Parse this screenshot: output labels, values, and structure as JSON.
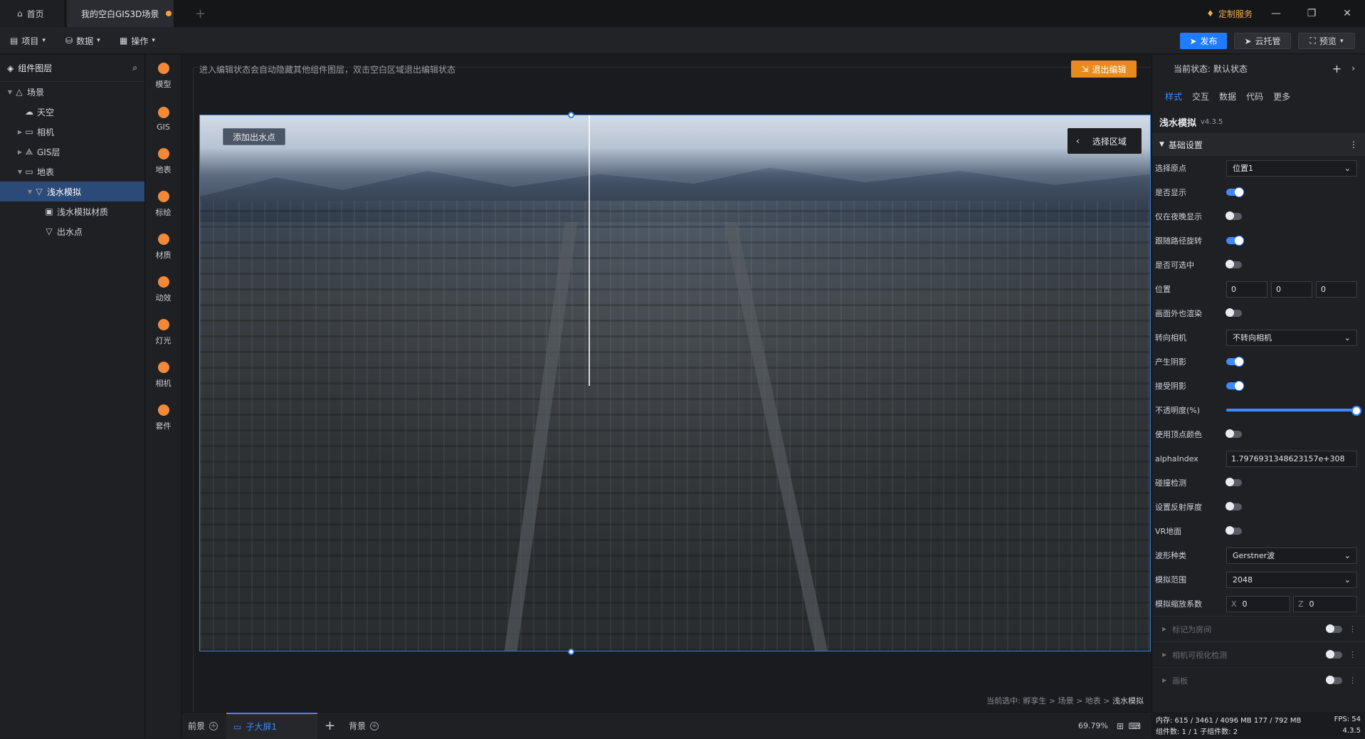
{
  "tabs": {
    "home": "首页",
    "project": "我的空白GIS3D场景"
  },
  "custom_service": "定制服务",
  "menu": {
    "project": "项目",
    "data": "数据",
    "operate": "操作"
  },
  "toolbar": {
    "publish": "发布",
    "cloud": "云托管",
    "preview": "预览"
  },
  "layers": {
    "title": "组件图层",
    "items": [
      {
        "label": "场景",
        "level": 0,
        "caret": "▼",
        "icon": "mountain-icon"
      },
      {
        "label": "天空",
        "level": 1,
        "caret": "",
        "icon": "cloud-icon"
      },
      {
        "label": "相机",
        "level": 1,
        "caret": "▶",
        "icon": "folder-icon"
      },
      {
        "label": "GIS层",
        "level": 1,
        "caret": "▶",
        "icon": "gis-icon"
      },
      {
        "label": "地表",
        "level": 1,
        "caret": "▼",
        "icon": "folder-icon"
      },
      {
        "label": "浅水模拟",
        "level": 2,
        "caret": "▼",
        "icon": "triangle-icon",
        "selected": true
      },
      {
        "label": "浅水模拟材质",
        "level": 3,
        "caret": "",
        "icon": "material-icon"
      },
      {
        "label": "出水点",
        "level": 3,
        "caret": "",
        "icon": "triangle-icon"
      }
    ]
  },
  "iconbar": [
    {
      "label": "模型",
      "icon": "model-icon"
    },
    {
      "label": "GIS",
      "icon": "gis-icon"
    },
    {
      "label": "地表",
      "icon": "terrain-icon"
    },
    {
      "label": "标绘",
      "icon": "marker-icon"
    },
    {
      "label": "材质",
      "icon": "material-icon"
    },
    {
      "label": "动效",
      "icon": "effect-icon"
    },
    {
      "label": "灯光",
      "icon": "light-icon"
    },
    {
      "label": "相机",
      "icon": "camera-icon"
    },
    {
      "label": "套件",
      "icon": "kit-icon"
    }
  ],
  "canvas": {
    "hint": "进入编辑状态会自动隐藏其他组件图层，双击空白区域退出编辑状态",
    "exit_edit": "退出编辑",
    "add_water_point": "添加出水点",
    "select_area": "选择区域",
    "breadcrumb_prefix": "当前选中: 孵孪生 > 场景 > 地表 > ",
    "breadcrumb_last": "浅水模拟"
  },
  "bottom": {
    "front": "前景",
    "child_screen": "子大屏1",
    "background": "背景",
    "zoom": "69.79%"
  },
  "right": {
    "state": "当前状态: 默认状态",
    "tabs": [
      "样式",
      "交互",
      "数据",
      "代码",
      "更多"
    ],
    "component": "浅水模拟",
    "version": "v4.3.5",
    "section": "基础设置",
    "props": {
      "origin": {
        "label": "选择原点",
        "value": "位置1"
      },
      "visible": {
        "label": "是否显示"
      },
      "night_only": {
        "label": "仅在夜晚显示"
      },
      "follow_path": {
        "label": "跟随路径旋转"
      },
      "selectable": {
        "label": "是否可选中"
      },
      "position": {
        "label": "位置",
        "x": "0",
        "y": "0",
        "z": "0"
      },
      "render_offscreen": {
        "label": "画面外也渲染"
      },
      "face_camera": {
        "label": "转向相机",
        "value": "不转向相机"
      },
      "cast_shadow": {
        "label": "产生阴影"
      },
      "receive_shadow": {
        "label": "接受阴影"
      },
      "opacity": {
        "label": "不透明度(%)",
        "value": 100
      },
      "vertex_color": {
        "label": "使用顶点颜色"
      },
      "alpha_index": {
        "label": "alphaIndex",
        "value": "1.7976931348623157e+308"
      },
      "collision": {
        "label": "碰撞检测"
      },
      "reflect_depth": {
        "label": "设置反射厚度"
      },
      "vr_ground": {
        "label": "VR地面"
      },
      "wave_type": {
        "label": "波形种类",
        "value": "Gerstner波"
      },
      "sim_range": {
        "label": "模拟范围",
        "value": "2048"
      },
      "sim_scale": {
        "label": "模拟缩放系数",
        "x_label": "X",
        "x": "0",
        "z_label": "Z",
        "z": "0"
      }
    },
    "subsections": [
      "标记为房间",
      "相机可视化检测",
      "画板"
    ]
  },
  "status": {
    "memory": "内存: 615 / 3461 / 4096 MB  177 / 792 MB",
    "fps": "FPS: 54",
    "components": "组件数: 1 / 1    子组件数: 2",
    "version": "4.3.5"
  }
}
